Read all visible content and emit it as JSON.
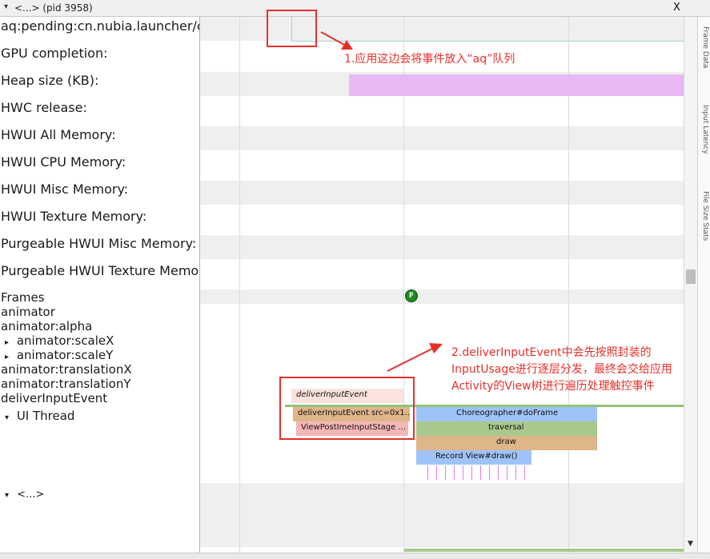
{
  "window": {
    "title": "<...> (pid 3958)",
    "close_label": "X"
  },
  "rows": [
    "aq:pending:cn.nubia.launcher/cc",
    "GPU completion:",
    "Heap size (KB):",
    "HWC release:",
    "HWUI All Memory:",
    "HWUI CPU Memory:",
    "HWUI Misc Memory:",
    "HWUI Texture Memory:",
    "Purgeable HWUI Misc Memory:",
    "Purgeable HWUI Texture Memo"
  ],
  "tree": {
    "frames": "Frames",
    "animator": "animator",
    "animator_alpha": "animator:alpha",
    "scalex": "animator:scaleX",
    "scaley": "animator:scaleY",
    "translationx": "animator:translationX",
    "translationy": "animator:translationY",
    "deliver": "deliverInputEvent",
    "ui_thread": "UI Thread",
    "collapsed": "<...>",
    "expand_glyph": "▸",
    "collapse_glyph": "▾"
  },
  "frame_marker": "F",
  "slices": {
    "deliver_italic": "deliverInputEvent",
    "deliver_src": "deliverInputEvent src=0x1...",
    "view_post": "ViewPostImeInputStage ...",
    "choreographer": "Choreographer#doFrame",
    "traversal": "traversal",
    "draw": "draw",
    "record": "Record View#draw()"
  },
  "side_tabs": [
    "Frame Data",
    "Input Latency",
    "File Size Stats"
  ],
  "annotations": {
    "note1": "1.应用这边会将事件放入“aq”队列",
    "note2_line1": "2.deliverInputEvent中会先按照封装的",
    "note2_line2": "InputUsage进行逐层分发，最终会交给应用",
    "note2_line3": "Activity的View树进行遍历处理触控事件"
  },
  "colors": {
    "annotation_red": "#e8302a",
    "heap_purple": "#e8b8f4",
    "slice_green": "#a9c98c",
    "slice_orange": "#dfb58a",
    "slice_blue": "#9ec3f7",
    "slice_pink": "#f6b6b6",
    "frame_marker": "#1f8a1f"
  },
  "icons": [
    "close-icon",
    "expand-arrow-icon",
    "collapse-arrow-icon",
    "scroll-down-icon"
  ]
}
